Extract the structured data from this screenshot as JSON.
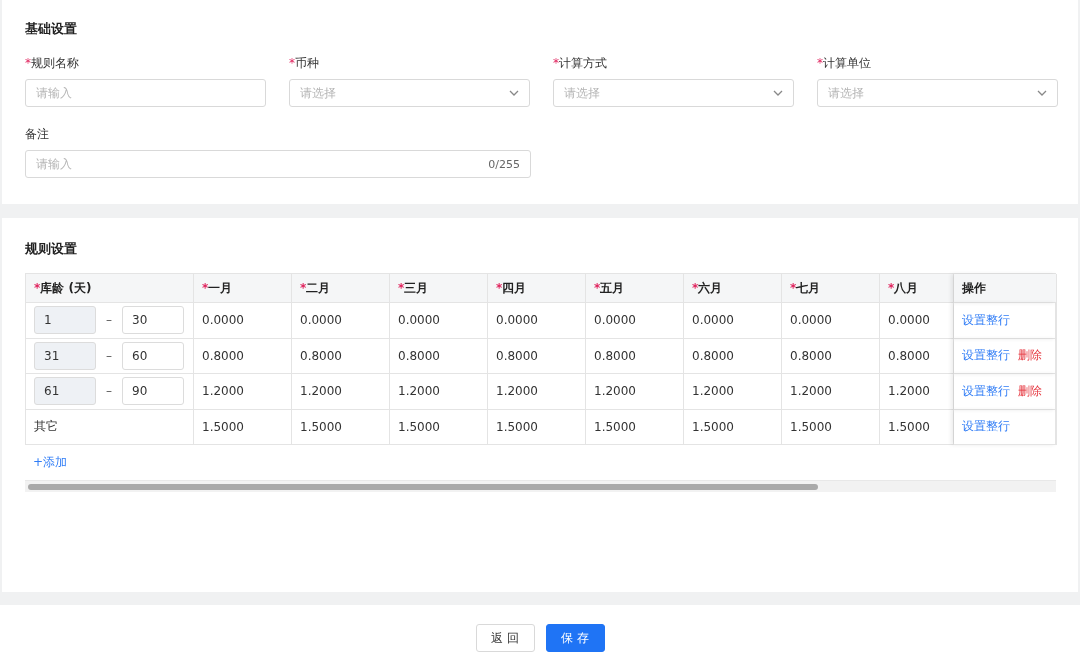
{
  "basic": {
    "title": "基础设置",
    "fields": [
      {
        "label": "规则名称",
        "mark": "*",
        "kind": "input",
        "placeholder": "请输入"
      },
      {
        "label": "币种",
        "mark": "*",
        "kind": "select",
        "placeholder": "请选择"
      },
      {
        "label": "计算方式",
        "mark": "*",
        "kind": "select",
        "placeholder": "请选择"
      },
      {
        "label": "计算单位",
        "mark": "*",
        "kind": "select",
        "placeholder": "请选择"
      }
    ],
    "remark": {
      "label": "备注",
      "placeholder": "请输入",
      "counter": "0/255"
    }
  },
  "rules": {
    "title": "规则设置",
    "columns": [
      {
        "label": "库龄 (天)",
        "mark": "*"
      },
      {
        "label": "一月",
        "mark": "*"
      },
      {
        "label": "二月",
        "mark": "*"
      },
      {
        "label": "三月",
        "mark": "*"
      },
      {
        "label": "四月",
        "mark": "*"
      },
      {
        "label": "五月",
        "mark": "*"
      },
      {
        "label": "六月",
        "mark": "*"
      },
      {
        "label": "七月",
        "mark": "*"
      },
      {
        "label": "八月",
        "mark": "*"
      },
      {
        "label": "操作"
      }
    ],
    "rows": [
      {
        "kind": "range",
        "from": "1",
        "to": "30",
        "dash": "–",
        "values": [
          "0.0000",
          "0.0000",
          "0.0000",
          "0.0000",
          "0.0000",
          "0.0000",
          "0.0000",
          "0.0000"
        ],
        "actions": [
          {
            "kind": "link",
            "label": "设置整行"
          }
        ]
      },
      {
        "kind": "range",
        "from": "31",
        "to": "60",
        "dash": "–",
        "values": [
          "0.8000",
          "0.8000",
          "0.8000",
          "0.8000",
          "0.8000",
          "0.8000",
          "0.8000",
          "0.8000"
        ],
        "actions": [
          {
            "kind": "link",
            "label": "设置整行"
          },
          {
            "kind": "danger",
            "label": "删除"
          }
        ]
      },
      {
        "kind": "range",
        "from": "61",
        "to": "90",
        "dash": "–",
        "values": [
          "1.2000",
          "1.2000",
          "1.2000",
          "1.2000",
          "1.2000",
          "1.2000",
          "1.2000",
          "1.2000"
        ],
        "actions": [
          {
            "kind": "link",
            "label": "设置整行"
          },
          {
            "kind": "danger",
            "label": "删除"
          }
        ]
      },
      {
        "kind": "text",
        "label": "其它",
        "values": [
          "1.5000",
          "1.5000",
          "1.5000",
          "1.5000",
          "1.5000",
          "1.5000",
          "1.5000",
          "1.5000"
        ],
        "actions": [
          {
            "kind": "link",
            "label": "设置整行"
          }
        ]
      }
    ],
    "add": "+添加"
  },
  "footer": {
    "buttons": [
      {
        "kind": "default",
        "label": "返 回"
      },
      {
        "kind": "primary",
        "label": "保 存"
      }
    ]
  }
}
